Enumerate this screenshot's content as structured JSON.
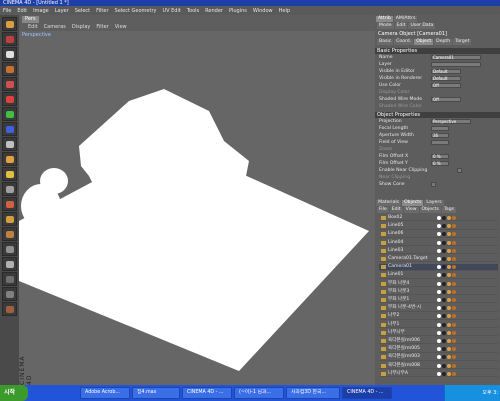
{
  "window": {
    "title": "CINEMA 4D - [Untitled 1 *]"
  },
  "menubar": [
    "File",
    "Edit",
    "Image",
    "Layer",
    "Select",
    "Filter",
    "Select Geometry",
    "UV Edit",
    "Tools",
    "Render",
    "Plugins",
    "Window",
    "Help"
  ],
  "viewport": {
    "tabs": [
      "Pers"
    ],
    "menu": [
      "Edit",
      "Cameras",
      "Display",
      "Filter",
      "View"
    ],
    "camera_label": "Perspective",
    "side_label": "CINEMA 4D"
  },
  "attributes": {
    "manager_tabs": [
      "Attrib",
      "AM/Attrs"
    ],
    "menu": [
      "Mode",
      "Edit",
      "User Data"
    ],
    "object_title": "Camera Object [Camera01]",
    "sub_tabs": [
      "Basic",
      "Coord.",
      "Object",
      "Depth",
      "Target"
    ],
    "basic_header": "Basic Properties",
    "basic": [
      {
        "label": "Name",
        "value": "Camera01",
        "dim": false
      },
      {
        "label": "Layer",
        "value": "",
        "dim": false
      },
      {
        "label": "Visible in Editor",
        "value": "Default",
        "dim": false
      },
      {
        "label": "Visible in Renderer",
        "value": "Default",
        "dim": false
      },
      {
        "label": "Use Color",
        "value": "Off",
        "dim": false
      },
      {
        "label": "Display Color",
        "value": "",
        "dim": true
      },
      {
        "label": "Shaded Wire Mode",
        "value": "Off",
        "dim": false
      },
      {
        "label": "Shaded Wire Color",
        "value": "",
        "dim": true
      }
    ],
    "object_header": "Object Properties",
    "object": [
      {
        "label": "Projection",
        "value": "Perspective",
        "dim": false
      },
      {
        "label": "Focal Length",
        "value": "",
        "dim": false
      },
      {
        "label": "Aperture Width",
        "value": "36",
        "dim": false
      },
      {
        "label": "Field of View",
        "value": "",
        "dim": false
      },
      {
        "label": "Zoom",
        "value": "",
        "dim": true
      },
      {
        "label": "Film Offset X",
        "value": "0 %",
        "dim": false
      },
      {
        "label": "Film Offset Y",
        "value": "0 %",
        "dim": false
      },
      {
        "label": "Enable Near Clipping",
        "value": "",
        "dim": false
      },
      {
        "label": "Near Clipping",
        "value": "",
        "dim": true
      },
      {
        "label": "Show Cone",
        "value": "",
        "dim": false
      }
    ]
  },
  "objects_panel": {
    "tabs": [
      "Materials",
      "Objects",
      "Layers"
    ],
    "menu": [
      "File",
      "Edit",
      "View",
      "Objects",
      "Tags"
    ],
    "items": [
      "Box02",
      "Line05",
      "Line06",
      "Line04",
      "Line03",
      "Camera01.Target",
      "Camera01",
      "Line01",
      "부좌 나뭇4",
      "부좌 나뭇3",
      "부좌 나뭇1",
      "부좌 나뭇-4번-시",
      "나무2",
      "나무1",
      "나무나무",
      "육다본실rm006",
      "육다본실rm005",
      "육다본실rm003",
      "육다본실rm008",
      "나무나무A"
    ],
    "selected": "Camera01"
  },
  "taskbar": {
    "start": "시작",
    "items": [
      "Adobe Acrob...",
      "집4.max",
      "CINEMA 4D - ...",
      "(~이)-1 님과...",
      "사과컴3D 한국...",
      "CINEMA 4D - ..."
    ],
    "active_index": 5,
    "clock": "오후 3:"
  },
  "colors": {
    "accent": "#2154d8",
    "panel": "#5d5d5d",
    "viewport": "#666666"
  }
}
